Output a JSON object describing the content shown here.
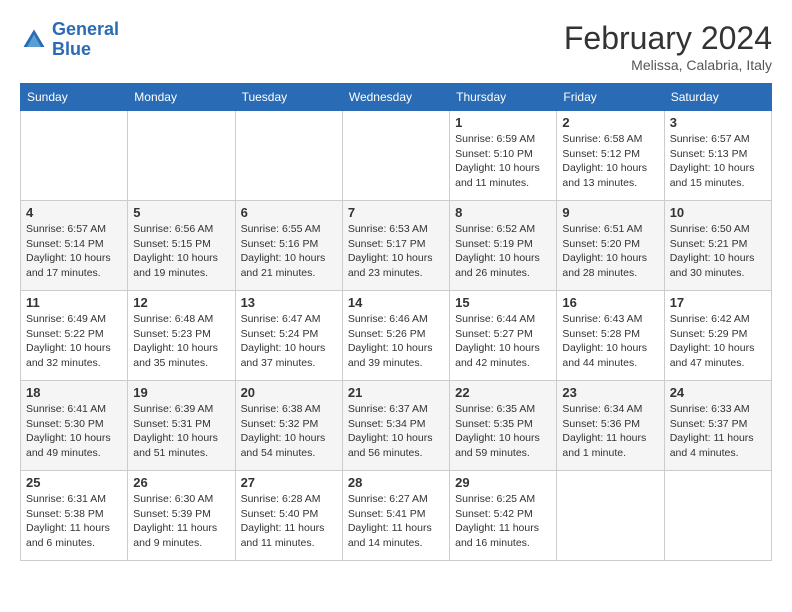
{
  "header": {
    "logo_line1": "General",
    "logo_line2": "Blue",
    "month": "February 2024",
    "location": "Melissa, Calabria, Italy"
  },
  "weekdays": [
    "Sunday",
    "Monday",
    "Tuesday",
    "Wednesday",
    "Thursday",
    "Friday",
    "Saturday"
  ],
  "weeks": [
    [
      {
        "day": "",
        "info": ""
      },
      {
        "day": "",
        "info": ""
      },
      {
        "day": "",
        "info": ""
      },
      {
        "day": "",
        "info": ""
      },
      {
        "day": "1",
        "info": "Sunrise: 6:59 AM\nSunset: 5:10 PM\nDaylight: 10 hours\nand 11 minutes."
      },
      {
        "day": "2",
        "info": "Sunrise: 6:58 AM\nSunset: 5:12 PM\nDaylight: 10 hours\nand 13 minutes."
      },
      {
        "day": "3",
        "info": "Sunrise: 6:57 AM\nSunset: 5:13 PM\nDaylight: 10 hours\nand 15 minutes."
      }
    ],
    [
      {
        "day": "4",
        "info": "Sunrise: 6:57 AM\nSunset: 5:14 PM\nDaylight: 10 hours\nand 17 minutes."
      },
      {
        "day": "5",
        "info": "Sunrise: 6:56 AM\nSunset: 5:15 PM\nDaylight: 10 hours\nand 19 minutes."
      },
      {
        "day": "6",
        "info": "Sunrise: 6:55 AM\nSunset: 5:16 PM\nDaylight: 10 hours\nand 21 minutes."
      },
      {
        "day": "7",
        "info": "Sunrise: 6:53 AM\nSunset: 5:17 PM\nDaylight: 10 hours\nand 23 minutes."
      },
      {
        "day": "8",
        "info": "Sunrise: 6:52 AM\nSunset: 5:19 PM\nDaylight: 10 hours\nand 26 minutes."
      },
      {
        "day": "9",
        "info": "Sunrise: 6:51 AM\nSunset: 5:20 PM\nDaylight: 10 hours\nand 28 minutes."
      },
      {
        "day": "10",
        "info": "Sunrise: 6:50 AM\nSunset: 5:21 PM\nDaylight: 10 hours\nand 30 minutes."
      }
    ],
    [
      {
        "day": "11",
        "info": "Sunrise: 6:49 AM\nSunset: 5:22 PM\nDaylight: 10 hours\nand 32 minutes."
      },
      {
        "day": "12",
        "info": "Sunrise: 6:48 AM\nSunset: 5:23 PM\nDaylight: 10 hours\nand 35 minutes."
      },
      {
        "day": "13",
        "info": "Sunrise: 6:47 AM\nSunset: 5:24 PM\nDaylight: 10 hours\nand 37 minutes."
      },
      {
        "day": "14",
        "info": "Sunrise: 6:46 AM\nSunset: 5:26 PM\nDaylight: 10 hours\nand 39 minutes."
      },
      {
        "day": "15",
        "info": "Sunrise: 6:44 AM\nSunset: 5:27 PM\nDaylight: 10 hours\nand 42 minutes."
      },
      {
        "day": "16",
        "info": "Sunrise: 6:43 AM\nSunset: 5:28 PM\nDaylight: 10 hours\nand 44 minutes."
      },
      {
        "day": "17",
        "info": "Sunrise: 6:42 AM\nSunset: 5:29 PM\nDaylight: 10 hours\nand 47 minutes."
      }
    ],
    [
      {
        "day": "18",
        "info": "Sunrise: 6:41 AM\nSunset: 5:30 PM\nDaylight: 10 hours\nand 49 minutes."
      },
      {
        "day": "19",
        "info": "Sunrise: 6:39 AM\nSunset: 5:31 PM\nDaylight: 10 hours\nand 51 minutes."
      },
      {
        "day": "20",
        "info": "Sunrise: 6:38 AM\nSunset: 5:32 PM\nDaylight: 10 hours\nand 54 minutes."
      },
      {
        "day": "21",
        "info": "Sunrise: 6:37 AM\nSunset: 5:34 PM\nDaylight: 10 hours\nand 56 minutes."
      },
      {
        "day": "22",
        "info": "Sunrise: 6:35 AM\nSunset: 5:35 PM\nDaylight: 10 hours\nand 59 minutes."
      },
      {
        "day": "23",
        "info": "Sunrise: 6:34 AM\nSunset: 5:36 PM\nDaylight: 11 hours\nand 1 minute."
      },
      {
        "day": "24",
        "info": "Sunrise: 6:33 AM\nSunset: 5:37 PM\nDaylight: 11 hours\nand 4 minutes."
      }
    ],
    [
      {
        "day": "25",
        "info": "Sunrise: 6:31 AM\nSunset: 5:38 PM\nDaylight: 11 hours\nand 6 minutes."
      },
      {
        "day": "26",
        "info": "Sunrise: 6:30 AM\nSunset: 5:39 PM\nDaylight: 11 hours\nand 9 minutes."
      },
      {
        "day": "27",
        "info": "Sunrise: 6:28 AM\nSunset: 5:40 PM\nDaylight: 11 hours\nand 11 minutes."
      },
      {
        "day": "28",
        "info": "Sunrise: 6:27 AM\nSunset: 5:41 PM\nDaylight: 11 hours\nand 14 minutes."
      },
      {
        "day": "29",
        "info": "Sunrise: 6:25 AM\nSunset: 5:42 PM\nDaylight: 11 hours\nand 16 minutes."
      },
      {
        "day": "",
        "info": ""
      },
      {
        "day": "",
        "info": ""
      }
    ]
  ]
}
